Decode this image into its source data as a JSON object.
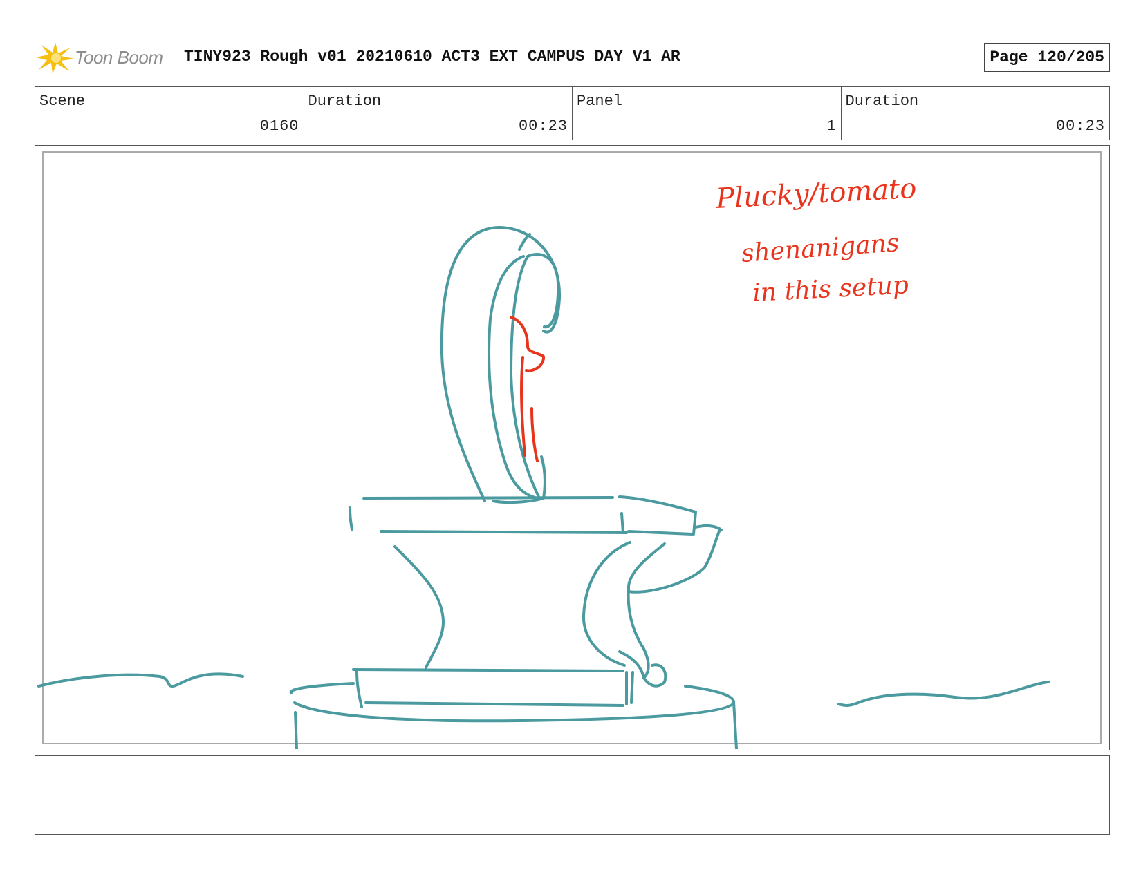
{
  "header": {
    "logo_text": "Toon Boom",
    "title": "TINY923 Rough v01 20210610 ACT3 EXT CAMPUS DAY V1 AR",
    "page": "Page 120/205"
  },
  "info": {
    "scene_label": "Scene",
    "scene_value": "0160",
    "duration_label": "Duration",
    "duration_value": "00:23",
    "panel_label": "Panel",
    "panel_value": "1",
    "panel_duration_label": "Duration",
    "panel_duration_value": "00:23"
  },
  "panel": {
    "annotation_line1": "Plucky/tomato",
    "annotation_line2": "shenanigans",
    "annotation_line3": "in this setup",
    "sketch_color": "#4a9aa0",
    "annotation_color": "#e8341c"
  },
  "notes": {
    "text": ""
  }
}
